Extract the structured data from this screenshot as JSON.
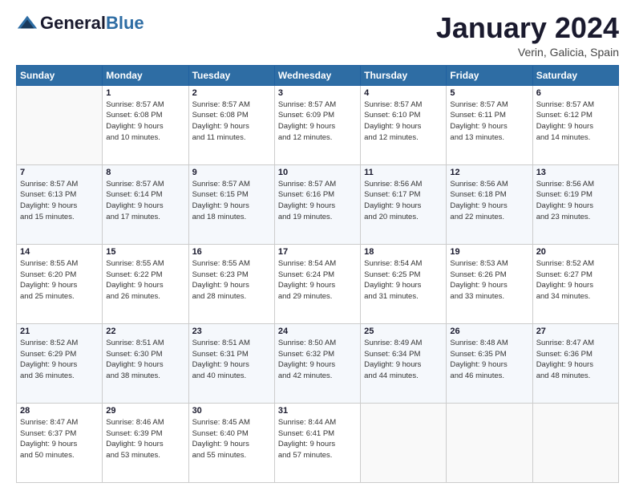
{
  "header": {
    "logo_general": "General",
    "logo_blue": "Blue",
    "month": "January 2024",
    "location": "Verin, Galicia, Spain"
  },
  "days_of_week": [
    "Sunday",
    "Monday",
    "Tuesday",
    "Wednesday",
    "Thursday",
    "Friday",
    "Saturday"
  ],
  "weeks": [
    [
      {
        "day": "",
        "sunrise": "",
        "sunset": "",
        "daylight": ""
      },
      {
        "day": "1",
        "sunrise": "Sunrise: 8:57 AM",
        "sunset": "Sunset: 6:08 PM",
        "daylight": "Daylight: 9 hours and 10 minutes."
      },
      {
        "day": "2",
        "sunrise": "Sunrise: 8:57 AM",
        "sunset": "Sunset: 6:08 PM",
        "daylight": "Daylight: 9 hours and 11 minutes."
      },
      {
        "day": "3",
        "sunrise": "Sunrise: 8:57 AM",
        "sunset": "Sunset: 6:09 PM",
        "daylight": "Daylight: 9 hours and 12 minutes."
      },
      {
        "day": "4",
        "sunrise": "Sunrise: 8:57 AM",
        "sunset": "Sunset: 6:10 PM",
        "daylight": "Daylight: 9 hours and 12 minutes."
      },
      {
        "day": "5",
        "sunrise": "Sunrise: 8:57 AM",
        "sunset": "Sunset: 6:11 PM",
        "daylight": "Daylight: 9 hours and 13 minutes."
      },
      {
        "day": "6",
        "sunrise": "Sunrise: 8:57 AM",
        "sunset": "Sunset: 6:12 PM",
        "daylight": "Daylight: 9 hours and 14 minutes."
      }
    ],
    [
      {
        "day": "7",
        "sunrise": "Sunrise: 8:57 AM",
        "sunset": "Sunset: 6:13 PM",
        "daylight": "Daylight: 9 hours and 15 minutes."
      },
      {
        "day": "8",
        "sunrise": "Sunrise: 8:57 AM",
        "sunset": "Sunset: 6:14 PM",
        "daylight": "Daylight: 9 hours and 17 minutes."
      },
      {
        "day": "9",
        "sunrise": "Sunrise: 8:57 AM",
        "sunset": "Sunset: 6:15 PM",
        "daylight": "Daylight: 9 hours and 18 minutes."
      },
      {
        "day": "10",
        "sunrise": "Sunrise: 8:57 AM",
        "sunset": "Sunset: 6:16 PM",
        "daylight": "Daylight: 9 hours and 19 minutes."
      },
      {
        "day": "11",
        "sunrise": "Sunrise: 8:56 AM",
        "sunset": "Sunset: 6:17 PM",
        "daylight": "Daylight: 9 hours and 20 minutes."
      },
      {
        "day": "12",
        "sunrise": "Sunrise: 8:56 AM",
        "sunset": "Sunset: 6:18 PM",
        "daylight": "Daylight: 9 hours and 22 minutes."
      },
      {
        "day": "13",
        "sunrise": "Sunrise: 8:56 AM",
        "sunset": "Sunset: 6:19 PM",
        "daylight": "Daylight: 9 hours and 23 minutes."
      }
    ],
    [
      {
        "day": "14",
        "sunrise": "Sunrise: 8:55 AM",
        "sunset": "Sunset: 6:20 PM",
        "daylight": "Daylight: 9 hours and 25 minutes."
      },
      {
        "day": "15",
        "sunrise": "Sunrise: 8:55 AM",
        "sunset": "Sunset: 6:22 PM",
        "daylight": "Daylight: 9 hours and 26 minutes."
      },
      {
        "day": "16",
        "sunrise": "Sunrise: 8:55 AM",
        "sunset": "Sunset: 6:23 PM",
        "daylight": "Daylight: 9 hours and 28 minutes."
      },
      {
        "day": "17",
        "sunrise": "Sunrise: 8:54 AM",
        "sunset": "Sunset: 6:24 PM",
        "daylight": "Daylight: 9 hours and 29 minutes."
      },
      {
        "day": "18",
        "sunrise": "Sunrise: 8:54 AM",
        "sunset": "Sunset: 6:25 PM",
        "daylight": "Daylight: 9 hours and 31 minutes."
      },
      {
        "day": "19",
        "sunrise": "Sunrise: 8:53 AM",
        "sunset": "Sunset: 6:26 PM",
        "daylight": "Daylight: 9 hours and 33 minutes."
      },
      {
        "day": "20",
        "sunrise": "Sunrise: 8:52 AM",
        "sunset": "Sunset: 6:27 PM",
        "daylight": "Daylight: 9 hours and 34 minutes."
      }
    ],
    [
      {
        "day": "21",
        "sunrise": "Sunrise: 8:52 AM",
        "sunset": "Sunset: 6:29 PM",
        "daylight": "Daylight: 9 hours and 36 minutes."
      },
      {
        "day": "22",
        "sunrise": "Sunrise: 8:51 AM",
        "sunset": "Sunset: 6:30 PM",
        "daylight": "Daylight: 9 hours and 38 minutes."
      },
      {
        "day": "23",
        "sunrise": "Sunrise: 8:51 AM",
        "sunset": "Sunset: 6:31 PM",
        "daylight": "Daylight: 9 hours and 40 minutes."
      },
      {
        "day": "24",
        "sunrise": "Sunrise: 8:50 AM",
        "sunset": "Sunset: 6:32 PM",
        "daylight": "Daylight: 9 hours and 42 minutes."
      },
      {
        "day": "25",
        "sunrise": "Sunrise: 8:49 AM",
        "sunset": "Sunset: 6:34 PM",
        "daylight": "Daylight: 9 hours and 44 minutes."
      },
      {
        "day": "26",
        "sunrise": "Sunrise: 8:48 AM",
        "sunset": "Sunset: 6:35 PM",
        "daylight": "Daylight: 9 hours and 46 minutes."
      },
      {
        "day": "27",
        "sunrise": "Sunrise: 8:47 AM",
        "sunset": "Sunset: 6:36 PM",
        "daylight": "Daylight: 9 hours and 48 minutes."
      }
    ],
    [
      {
        "day": "28",
        "sunrise": "Sunrise: 8:47 AM",
        "sunset": "Sunset: 6:37 PM",
        "daylight": "Daylight: 9 hours and 50 minutes."
      },
      {
        "day": "29",
        "sunrise": "Sunrise: 8:46 AM",
        "sunset": "Sunset: 6:39 PM",
        "daylight": "Daylight: 9 hours and 53 minutes."
      },
      {
        "day": "30",
        "sunrise": "Sunrise: 8:45 AM",
        "sunset": "Sunset: 6:40 PM",
        "daylight": "Daylight: 9 hours and 55 minutes."
      },
      {
        "day": "31",
        "sunrise": "Sunrise: 8:44 AM",
        "sunset": "Sunset: 6:41 PM",
        "daylight": "Daylight: 9 hours and 57 minutes."
      },
      {
        "day": "",
        "sunrise": "",
        "sunset": "",
        "daylight": ""
      },
      {
        "day": "",
        "sunrise": "",
        "sunset": "",
        "daylight": ""
      },
      {
        "day": "",
        "sunrise": "",
        "sunset": "",
        "daylight": ""
      }
    ]
  ]
}
